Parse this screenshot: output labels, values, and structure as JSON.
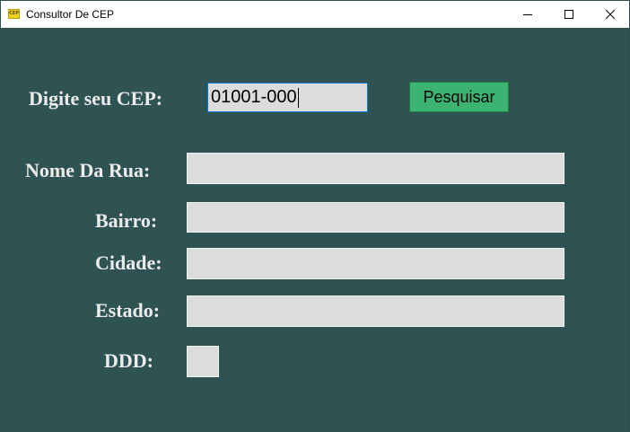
{
  "window": {
    "title": "Consultor De CEP",
    "icon": "app-icon",
    "controls": [
      "minimize-icon",
      "maximize-icon",
      "close-icon"
    ]
  },
  "form": {
    "cep_label": "Digite seu CEP:",
    "cep_value": "01001-000",
    "search_button": "Pesquisar",
    "rua_label": "Nome Da Rua:",
    "rua_value": "",
    "bairro_label": "Bairro:",
    "bairro_value": "",
    "cidade_label": "Cidade:",
    "cidade_value": "",
    "estado_label": "Estado:",
    "estado_value": "",
    "ddd_label": "DDD:",
    "ddd_value": ""
  },
  "colors": {
    "background": "#2f5252",
    "button": "#3cb371",
    "field": "#dcdcdc",
    "label_text": "#ececec"
  }
}
